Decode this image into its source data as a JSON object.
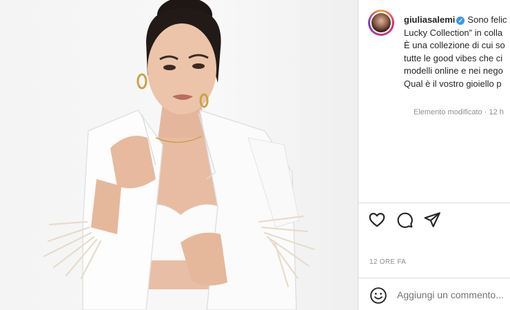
{
  "post": {
    "username": "giuliasalemi",
    "caption_lines": [
      "Sono felic",
      "Lucky Collection” in colla",
      "È una collezione di cui so",
      "tutte le good vibes che ci",
      "modelli online e nei nego",
      "Qual è il vostro gioiello p"
    ],
    "edited_label": "Elemento modificato",
    "edited_time": "12 h",
    "time_ago": "12 ORE FA"
  },
  "comment": {
    "placeholder": "Aggiungi un commento..."
  },
  "icons": {
    "like": "heart-icon",
    "comment": "comment-icon",
    "share": "share-icon",
    "emoji": "emoji-icon",
    "verified": "verified-badge-icon"
  },
  "colors": {
    "verified_blue": "#3897f0",
    "muted_text": "#8e8e8e",
    "divider": "#dbdbdb"
  }
}
